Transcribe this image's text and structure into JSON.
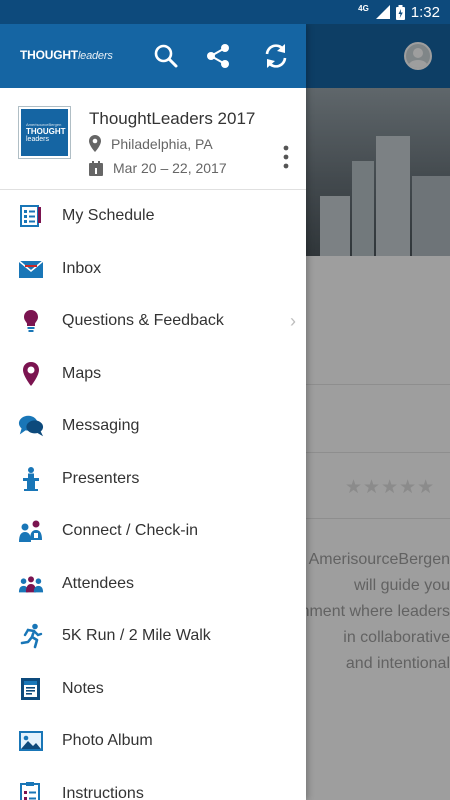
{
  "status": {
    "network": "4G",
    "time": "1:32"
  },
  "drawer": {
    "logo": {
      "small": "AmerisourceBergen",
      "thought": "THOUGHT",
      "leaders": "leaders"
    },
    "header_icons": [
      "search-icon",
      "share-icon",
      "refresh-icon"
    ],
    "event": {
      "logo": {
        "small": "AmerisourceBergen",
        "line1": "THOUGHT",
        "line2": "leaders"
      },
      "title": "ThoughtLeaders 2017",
      "location": "Philadelphia, PA",
      "dates": "Mar 20 – 22, 2017"
    },
    "menu": [
      {
        "label": "My Schedule",
        "icon": "schedule-icon"
      },
      {
        "label": "Inbox",
        "icon": "inbox-icon"
      },
      {
        "label": "Questions & Feedback",
        "icon": "lightbulb-icon",
        "has_submenu": true
      },
      {
        "label": "Maps",
        "icon": "map-pin-icon"
      },
      {
        "label": "Messaging",
        "icon": "chat-icon"
      },
      {
        "label": "Presenters",
        "icon": "podium-icon"
      },
      {
        "label": "Connect / Check-in",
        "icon": "connect-icon"
      },
      {
        "label": "Attendees",
        "icon": "people-icon"
      },
      {
        "label": "5K Run / 2 Mile Walk",
        "icon": "runner-icon"
      },
      {
        "label": "Notes",
        "icon": "notes-icon"
      },
      {
        "label": "Photo Album",
        "icon": "photo-icon"
      },
      {
        "label": "Instructions",
        "icon": "clipboard-icon"
      }
    ]
  },
  "background": {
    "text_lines": [
      "AmerisourceBergen",
      "will guide you",
      "environment where leaders",
      "in collaborative",
      "and intentional"
    ]
  },
  "colors": {
    "primary": "#1565a3",
    "status_bar": "#0d4a7c",
    "accent_icon": "#1976b7",
    "maps_icon": "#7b1450"
  }
}
